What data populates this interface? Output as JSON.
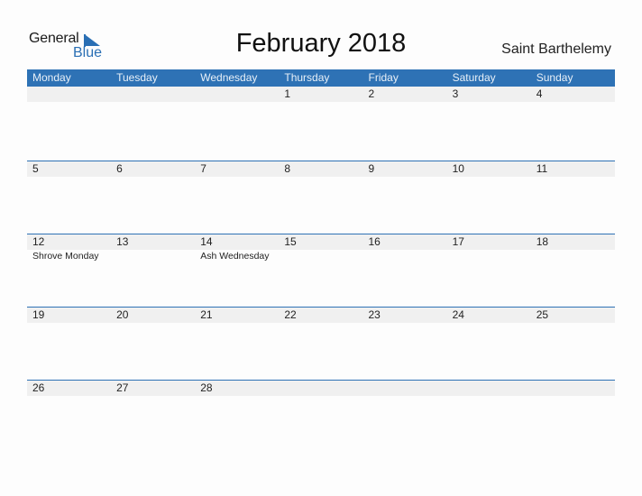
{
  "logo": {
    "line1": "General",
    "line2": "Blue"
  },
  "title": "February 2018",
  "country": "Saint Barthelemy",
  "colors": {
    "accent": "#2e72b5",
    "strip": "#f0f0f0"
  },
  "weekdays": [
    "Monday",
    "Tuesday",
    "Wednesday",
    "Thursday",
    "Friday",
    "Saturday",
    "Sunday"
  ],
  "weeks": [
    {
      "days": [
        {
          "d": "",
          "e": ""
        },
        {
          "d": "",
          "e": ""
        },
        {
          "d": "",
          "e": ""
        },
        {
          "d": "1",
          "e": ""
        },
        {
          "d": "2",
          "e": ""
        },
        {
          "d": "3",
          "e": ""
        },
        {
          "d": "4",
          "e": ""
        }
      ]
    },
    {
      "days": [
        {
          "d": "5",
          "e": ""
        },
        {
          "d": "6",
          "e": ""
        },
        {
          "d": "7",
          "e": ""
        },
        {
          "d": "8",
          "e": ""
        },
        {
          "d": "9",
          "e": ""
        },
        {
          "d": "10",
          "e": ""
        },
        {
          "d": "11",
          "e": ""
        }
      ]
    },
    {
      "days": [
        {
          "d": "12",
          "e": "Shrove Monday"
        },
        {
          "d": "13",
          "e": ""
        },
        {
          "d": "14",
          "e": "Ash Wednesday"
        },
        {
          "d": "15",
          "e": ""
        },
        {
          "d": "16",
          "e": ""
        },
        {
          "d": "17",
          "e": ""
        },
        {
          "d": "18",
          "e": ""
        }
      ]
    },
    {
      "days": [
        {
          "d": "19",
          "e": ""
        },
        {
          "d": "20",
          "e": ""
        },
        {
          "d": "21",
          "e": ""
        },
        {
          "d": "22",
          "e": ""
        },
        {
          "d": "23",
          "e": ""
        },
        {
          "d": "24",
          "e": ""
        },
        {
          "d": "25",
          "e": ""
        }
      ]
    },
    {
      "days": [
        {
          "d": "26",
          "e": ""
        },
        {
          "d": "27",
          "e": ""
        },
        {
          "d": "28",
          "e": ""
        },
        {
          "d": "",
          "e": ""
        },
        {
          "d": "",
          "e": ""
        },
        {
          "d": "",
          "e": ""
        },
        {
          "d": "",
          "e": ""
        }
      ]
    }
  ]
}
